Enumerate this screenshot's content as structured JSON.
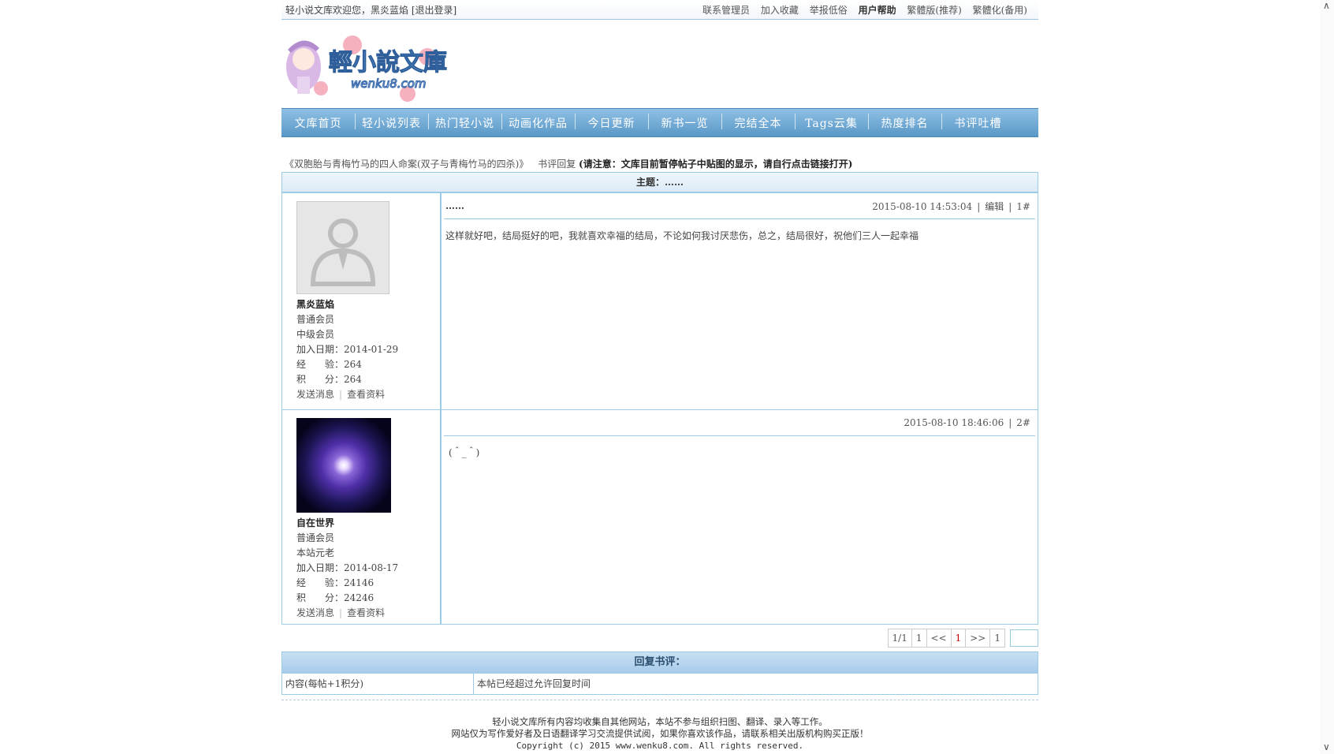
{
  "topbar": {
    "welcome": "轻小说文库欢迎您，黑炎蓝焰 [退出登录]",
    "links": [
      "联系管理员",
      "加入收藏",
      "举报低俗",
      "用户帮助",
      "繁體版(推荐)",
      "繁體化(备用)"
    ]
  },
  "logo": {
    "alt_text": "輕小說文庫 wenku8.com"
  },
  "nav": [
    "文库首页",
    "轻小说列表",
    "热门轻小说",
    "动画化作品",
    "今日更新",
    "新书一览",
    "完结全本",
    "Tags云集",
    "热度排名",
    "书评吐槽"
  ],
  "crumb": {
    "book": "《双胞胎与青梅竹马的四人命案(双子与青梅竹马的四杀)》",
    "section": "书评回复",
    "notice": "(请注意：文库目前暂停帖子中贴图的显示，请自行点击链接打开)"
  },
  "subject": "主题：……",
  "posts": [
    {
      "user": {
        "name": "黑炎蓝焰",
        "group": "普通会员",
        "level": "中级会员",
        "joined": "加入日期：2014-01-29",
        "exp": "经　　验：264",
        "points": "积　　分：264",
        "send_msg": "发送消息",
        "view_profile": "查看资料"
      },
      "title": "……",
      "time": "2015-08-10 14:53:04",
      "edit": "编辑",
      "floor": "1#",
      "content": "这样就好吧，结局挺好的吧，我就喜欢幸福的结局，不论如何我讨厌悲伤，总之，结局很好，祝他们三人一起幸福"
    },
    {
      "user": {
        "name": "自在世界",
        "group": "普通会员",
        "level": "本站元老",
        "joined": "加入日期：2014-08-17",
        "exp": "经　　验：24146",
        "points": "积　　分：24246",
        "send_msg": "发送消息",
        "view_profile": "查看资料"
      },
      "title": "",
      "time": "2015-08-10 18:46:06",
      "floor": "2#",
      "content": "(＾_＾)"
    }
  ],
  "pager": {
    "summary": "1/1",
    "first": "1",
    "prev": "<<",
    "current": "1",
    "next": ">>",
    "last": "1"
  },
  "reply": {
    "title": "回复书评：",
    "label": "内容(每帖+1积分)",
    "notice": "本帖已经超过允许回复时间"
  },
  "footer": {
    "line1": "轻小说文库所有内容均收集自其他网站，本站不参与组织扫图、翻译、录入等工作。",
    "line2": "网站仅为写作爱好者及日语翻译学习交流提供试阅，如果你喜欢该作品，请联系相关出版机构购买正版！",
    "line3": "Copyright (c) 2015 www.wenku8.com. All rights reserved."
  }
}
